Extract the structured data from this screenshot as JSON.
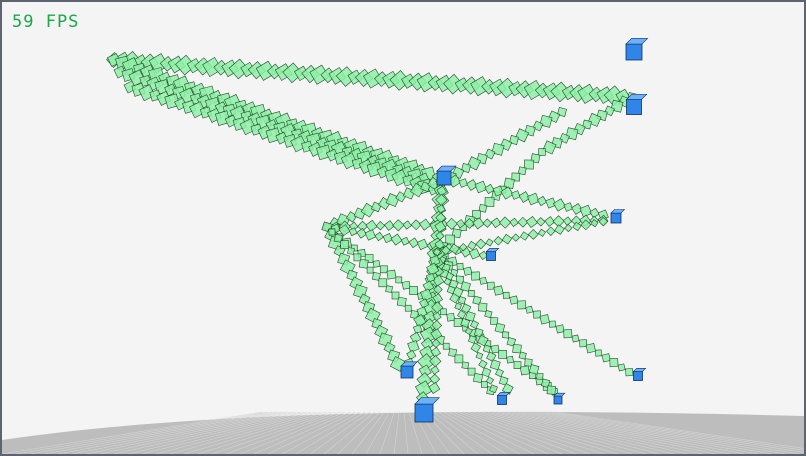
{
  "hud": {
    "fps_label": "59 FPS"
  },
  "colors": {
    "background": "#f4f4f4",
    "frame": "#5d6470",
    "fps_text": "#19a84a",
    "segment_fill": "#8ef0a6",
    "segment_stroke": "#1f4a2a",
    "end_cube": "#2f86e8",
    "floor": "#bdbdbd"
  }
}
